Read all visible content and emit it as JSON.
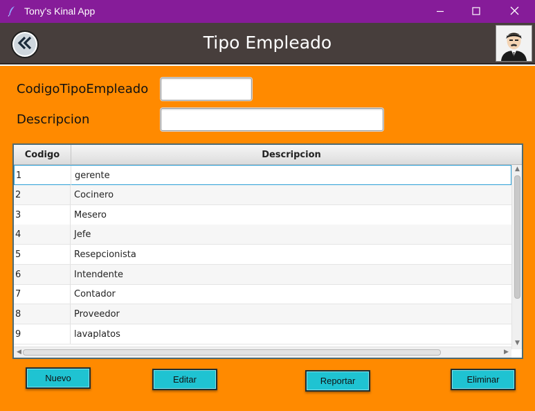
{
  "window": {
    "title": "Tony's Kinal App",
    "icon": "feather-icon",
    "controls": [
      "minimize-icon",
      "maximize-icon",
      "close-icon"
    ]
  },
  "header": {
    "title": "Tipo Empleado",
    "back_icon": "double-chevron-left-icon",
    "avatar_icon": "user-avatar-icon"
  },
  "form": {
    "codigo_label": "CodigoTipoEmpleado",
    "codigo_value": "",
    "descripcion_label": "Descripcion",
    "descripcion_value": ""
  },
  "table": {
    "columns": [
      "Codigo",
      "Descripcion"
    ],
    "rows": [
      {
        "codigo": "1",
        "descripcion": "gerente"
      },
      {
        "codigo": "2",
        "descripcion": "Cocinero"
      },
      {
        "codigo": "3",
        "descripcion": "Mesero"
      },
      {
        "codigo": "4",
        "descripcion": "Jefe"
      },
      {
        "codigo": "5",
        "descripcion": "Resepcionista"
      },
      {
        "codigo": "6",
        "descripcion": "Intendente"
      },
      {
        "codigo": "7",
        "descripcion": "Contador"
      },
      {
        "codigo": "8",
        "descripcion": "Proveedor"
      },
      {
        "codigo": "9",
        "descripcion": "lavaplatos"
      }
    ],
    "selected_index": 0
  },
  "buttons": {
    "nuevo": "Nuevo",
    "editar": "Editar",
    "reportar": "Reportar",
    "eliminar": "Eliminar"
  },
  "colors": {
    "titlebar": "#861c99",
    "header": "#473e3c",
    "background": "#ff8a00",
    "button": "#1fc3d2"
  }
}
